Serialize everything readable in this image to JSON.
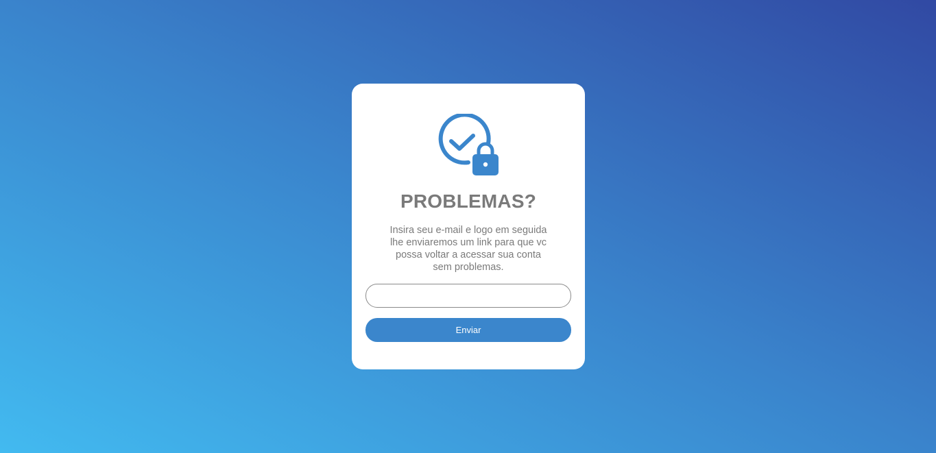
{
  "card": {
    "icon": "check-circle-lock-icon",
    "title": "PROBLEMAS?",
    "description": "Insira seu e-mail e logo em seguida lhe enviaremos um link para que vc possa voltar a acessar sua conta sem problemas.",
    "email_value": "",
    "email_placeholder": "",
    "submit_label": "Enviar"
  },
  "colors": {
    "accent": "#3b86cc",
    "text": "#7a7a7a",
    "gradient_start": "#42baf0",
    "gradient_end": "#3149a3"
  }
}
